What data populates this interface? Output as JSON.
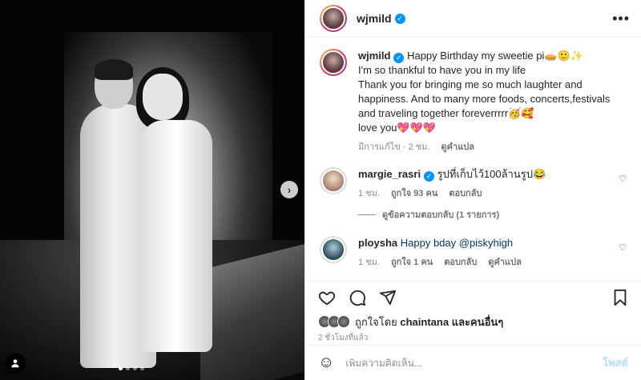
{
  "header": {
    "username": "wjmild",
    "more_icon": "more-horizontal-icon"
  },
  "caption": {
    "username": "wjmild",
    "lines": [
      "Happy Birthday my sweetie pi🥧🙂✨",
      "I'm so thankful to have you in my life",
      "Thank you for bringing me so much laughter and happiness. And to many more foods, concerts,festivals and traveling together foreverrrrr🥳🥰",
      "love you💖💖💖"
    ],
    "edited": "มีการแก้ไข · 2 ชม.",
    "translate": "ดูคำแปล"
  },
  "comments": [
    {
      "username": "margie_rasri",
      "verified": true,
      "text": "รูปที่เก็บไว้100ล้านรูป😂",
      "time": "1 ชม.",
      "likes": "ถูกใจ 93 คน",
      "reply": "ตอบกลับ",
      "translate": "",
      "view_replies": "ดูข้อความตอบกลับ (1 รายการ)"
    },
    {
      "username": "ploysha",
      "verified": false,
      "text": "Happy bday @piskyhigh",
      "time": "1 ชม.",
      "likes": "ถูกใจ 1 คน",
      "reply": "ตอบกลับ",
      "translate": "ดูคำแปล",
      "view_replies": ""
    }
  ],
  "likes_line": {
    "prefix": "ถูกใจโดย",
    "user": "chaintana",
    "suffix": "และคนอื่นๆ"
  },
  "post_time": "2 ชั่วโมงที่แล้ว",
  "composer": {
    "placeholder": "เพิ่มความคิดเห็น...",
    "post_label": "โพสต์"
  },
  "carousel": {
    "total_slides": 4,
    "active_slide": 1
  }
}
